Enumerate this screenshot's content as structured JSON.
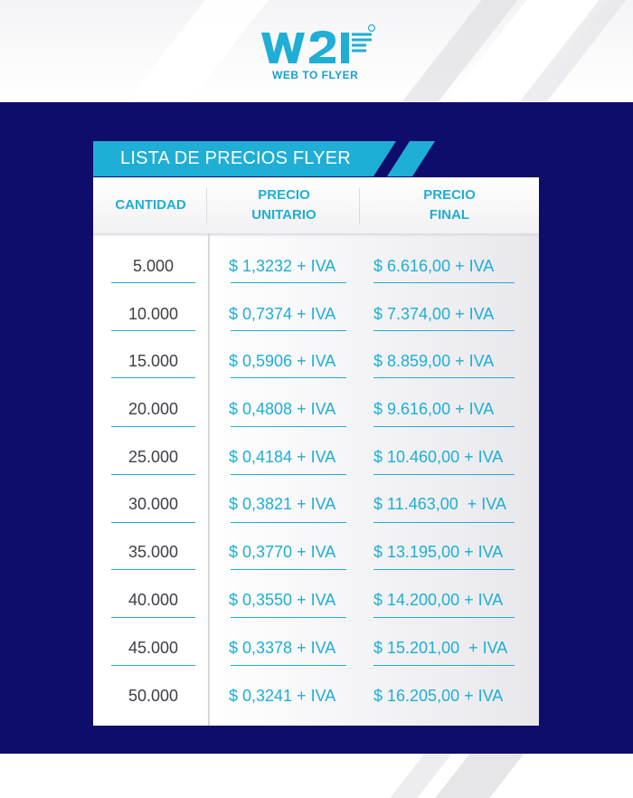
{
  "brand": {
    "logo_mark": "W2F",
    "tagline": "WEB TO FLYER",
    "colors": {
      "accent": "#1eaed6",
      "panel": "#0e0d6b",
      "quantity_text": "#3e3e46"
    }
  },
  "title": "LISTA DE PRECIOS FLYER",
  "table": {
    "headers": {
      "quantity": "CANTIDAD",
      "unit_price_line1": "PRECIO",
      "unit_price_line2": "UNITARIO",
      "final_price_line1": "PRECIO",
      "final_price_line2": "FINAL"
    },
    "rows": [
      {
        "quantity": "5.000",
        "unit_price": "$ 1,3232 + IVA",
        "final_price": "$ 6.616,00 + IVA"
      },
      {
        "quantity": "10.000",
        "unit_price": "$ 0,7374 + IVA",
        "final_price": "$ 7.374,00 + IVA"
      },
      {
        "quantity": "15.000",
        "unit_price": "$ 0,5906 + IVA",
        "final_price": "$ 8.859,00 + IVA"
      },
      {
        "quantity": "20.000",
        "unit_price": "$ 0,4808 + IVA",
        "final_price": "$ 9.616,00 + IVA"
      },
      {
        "quantity": "25.000",
        "unit_price": "$ 0,4184 + IVA",
        "final_price": "$ 10.460,00 + IVA"
      },
      {
        "quantity": "30.000",
        "unit_price": "$ 0,3821 + IVA",
        "final_price": "$ 11.463,00  + IVA"
      },
      {
        "quantity": "35.000",
        "unit_price": "$ 0,3770 + IVA",
        "final_price": "$ 13.195,00 + IVA"
      },
      {
        "quantity": "40.000",
        "unit_price": "$ 0,3550 + IVA",
        "final_price": "$ 14.200,00 + IVA"
      },
      {
        "quantity": "45.000",
        "unit_price": "$ 0,3378 + IVA",
        "final_price": "$ 15.201,00  + IVA"
      },
      {
        "quantity": "50.000",
        "unit_price": "$ 0,3241 + IVA",
        "final_price": "$ 16.205,00 + IVA"
      }
    ]
  }
}
